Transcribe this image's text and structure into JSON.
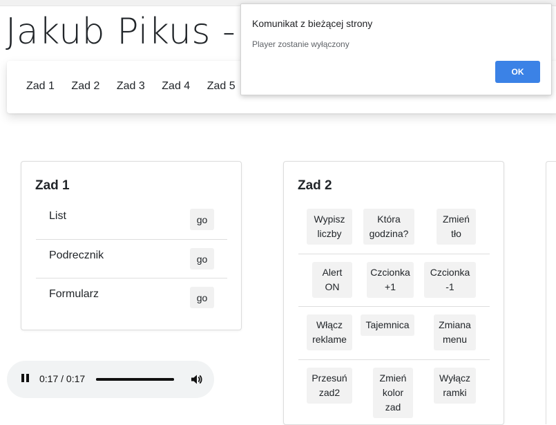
{
  "page": {
    "title": "Jakub Pikus - 2"
  },
  "nav": {
    "items": [
      "Zad 1",
      "Zad 2",
      "Zad 3",
      "Zad 4",
      "Zad 5"
    ]
  },
  "zad1": {
    "title": "Zad 1",
    "rows": [
      {
        "label": "List",
        "button": "go"
      },
      {
        "label": "Podrecznik",
        "button": "go"
      },
      {
        "label": "Formularz",
        "button": "go"
      }
    ]
  },
  "zad2": {
    "title": "Zad 2",
    "rows": [
      [
        "Wypisz liczby",
        "Która godzina?",
        "Zmień tło"
      ],
      [
        "Alert ON",
        "Czcionka +1",
        "Czcionka -1"
      ],
      [
        "Włącz reklame",
        "Tajemnica",
        "Zmiana menu"
      ],
      [
        "Przesuń zad2",
        "Zmień kolor zad",
        "Wyłącz ramki"
      ]
    ]
  },
  "player": {
    "time": "0:17 / 0:17",
    "progress": 1.0,
    "play_state": "pause-icon",
    "volume_icon": "volume-icon"
  },
  "dialog": {
    "title": "Komunikat z bieżącej strony",
    "message": "Player zostanie wyłączony",
    "ok_label": "OK",
    "ok_color": "#3b82e6"
  }
}
